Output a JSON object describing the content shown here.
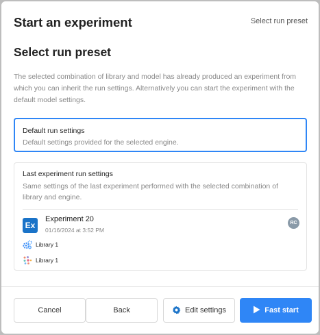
{
  "header": {
    "title": "Start an experiment",
    "step_label": "Select run preset"
  },
  "section": {
    "title": "Select run preset",
    "description": "The selected combination of library and model has already produced an experiment from which you can inherit the run settings. Alternatively you can start the experiment with the default model settings."
  },
  "options": {
    "default": {
      "title": "Default run settings",
      "subtitle": "Default settings provided for the selected engine.",
      "selected": true
    },
    "last": {
      "title": "Last experiment run settings",
      "subtitle": "Same settings of the last experiment performed with the selected combination of library and engine.",
      "experiment": {
        "icon_text": "Ex",
        "name": "Experiment 20",
        "date": "01/16/2024 at 3:52 PM",
        "avatar": "RC"
      },
      "libraries": [
        {
          "label": "Library 1",
          "icon": "gears-icon"
        },
        {
          "label": "Library 1",
          "icon": "dots-cluster-icon"
        }
      ]
    }
  },
  "footer": {
    "cancel_label": "Cancel",
    "back_label": "Back",
    "edit_label": "Edit settings",
    "fast_start_label": "Fast start"
  },
  "colors": {
    "accent": "#2f86f6",
    "experiment_icon": "#1a73c8",
    "avatar": "#8a9aa8"
  }
}
